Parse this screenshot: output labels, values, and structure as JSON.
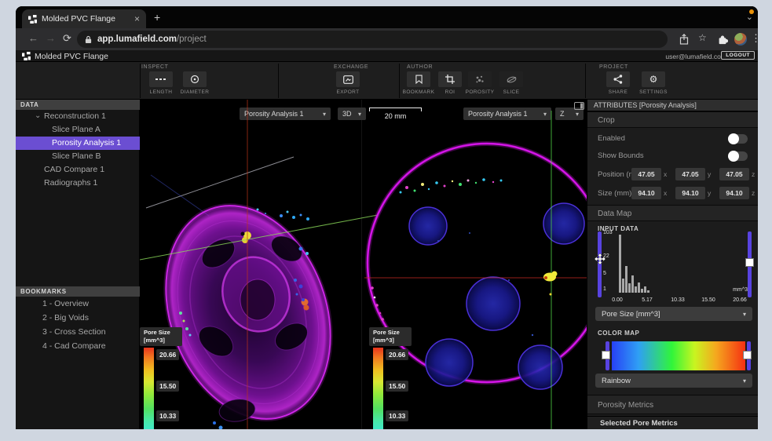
{
  "browser": {
    "tab": {
      "title": "Molded PVC Flange"
    },
    "url": {
      "domain": "app.lumafield.com",
      "path": "/project"
    }
  },
  "app_header": {
    "title": "Molded PVC Flange",
    "email": "user@lumafield.com",
    "logout_label": "LOGOUT"
  },
  "toolbar": {
    "groups": [
      {
        "label": "INSPECT",
        "buttons": [
          {
            "label": "LENGTH"
          },
          {
            "label": "DIAMETER"
          }
        ]
      },
      {
        "label": "EXCHANGE",
        "buttons": [
          {
            "label": "EXPORT"
          }
        ]
      },
      {
        "label": "AUTHOR",
        "buttons": [
          {
            "label": "BOOKMARK"
          },
          {
            "label": "ROI"
          },
          {
            "label": "POROSITY"
          },
          {
            "label": "SLICE"
          }
        ]
      },
      {
        "label": "PROJECT",
        "buttons": [
          {
            "label": "SHARE"
          },
          {
            "label": "SETTINGS"
          }
        ]
      }
    ]
  },
  "sidebar": {
    "data_header": "DATA",
    "tree": [
      {
        "label": "Reconstruction 1"
      },
      {
        "label": "Slice Plane A"
      },
      {
        "label": "Porosity Analysis 1"
      },
      {
        "label": "Slice Plane B"
      },
      {
        "label": "CAD Compare 1"
      },
      {
        "label": "Radiographs 1"
      }
    ],
    "bookmarks_header": "BOOKMARKS",
    "bookmarks": [
      {
        "label": "1 - Overview"
      },
      {
        "label": "2 - Big Voids"
      },
      {
        "label": "3 - Cross Section"
      },
      {
        "label": "4 - Cad Compare"
      }
    ]
  },
  "viewport": {
    "left_view": {
      "analysis_selector": "Porosity Analysis 1",
      "mode_selector": "3D",
      "scale_label": "20 mm"
    },
    "right_view": {
      "analysis_selector": "Porosity Analysis 1",
      "axis_selector": "Z"
    },
    "legend": {
      "title_line1": "Pore Size",
      "title_line2": "[mm^3]",
      "tick_values": [
        "20.66",
        "15.50",
        "10.33"
      ]
    }
  },
  "attributes": {
    "header": "ATTRIBUTES [Porosity Analysis]",
    "crop": {
      "section_label": "Crop",
      "enabled_label": "Enabled",
      "show_bounds_label": "Show Bounds",
      "position_label": "Position (mm)",
      "position": {
        "x": "47.05",
        "y": "47.05",
        "z": "47.05"
      },
      "size_label": "Size (mm)",
      "size": {
        "x": "94.10",
        "y": "94.10",
        "z": "94.10"
      },
      "axis_letters": {
        "x": "x",
        "y": "y",
        "z": "z"
      }
    },
    "data_map": {
      "section_label": "Data Map",
      "input_data_label": "INPUT DATA",
      "histogram": {
        "y_ticks": [
          "103",
          "22",
          "5",
          "1"
        ],
        "x_ticks": [
          "0.00",
          "5.17",
          "10.33",
          "15.50",
          "20.66"
        ],
        "unit": "mm^3",
        "bars": [
          74,
          18,
          34,
          12,
          22,
          8,
          13,
          5,
          8,
          3
        ]
      },
      "channel_selector": "Pore Size [mm^3]",
      "color_map_label": "COLOR MAP",
      "color_map_selector": "Rainbow"
    },
    "porosity_metrics_label": "Porosity Metrics",
    "selected_pore_metrics_label": "Selected Pore Metrics"
  }
}
